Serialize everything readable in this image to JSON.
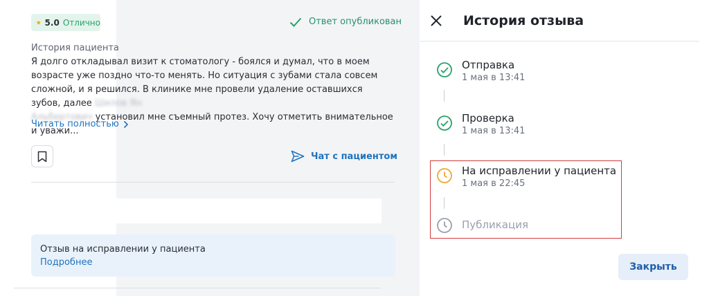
{
  "review": {
    "rating": "5.0",
    "rating_word": "Отлично",
    "published_status": "Ответ опубликован",
    "history_label": "История пациента",
    "text_part1": "Я долго откладывал визит к стоматологу - боялся и думал, что в моем возрасте уже поздно что-то менять. Но ситуация с зубами стала совсем сложной, и я решился. В клинике мне провели удаление оставшихся зубов, далее ",
    "text_blur1": "Шилов Ян",
    "text_blur2": "Альбертович",
    "text_part2": " установил мне съемный протез. Хочу отметить внимательное и уважи...",
    "read_more": "Читать полностью",
    "chat_label": "Чат с пациентом",
    "notice_text": "Отзыв на исправлении у пациента",
    "notice_link": "Подробнее"
  },
  "history_panel": {
    "title": "История отзыва",
    "steps": [
      {
        "name": "Отправка",
        "date": "1 мая в 13:41",
        "status": "done"
      },
      {
        "name": "Проверка",
        "date": "1 мая в 13:41",
        "status": "done"
      },
      {
        "name": "На исправлении у пациента",
        "date": "1 мая в 22:45",
        "status": "current"
      },
      {
        "name": "Публикация",
        "date": "",
        "status": "pending"
      }
    ],
    "close_label": "Закрыть"
  },
  "colors": {
    "success": "#28a26a",
    "warning": "#f0a733",
    "link": "#1e73be",
    "highlight": "#d23a3a"
  },
  "icons": [
    "star-icon",
    "check-icon",
    "chevron-right-icon",
    "bookmark-icon",
    "send-icon",
    "close-icon",
    "check-circle-icon",
    "clock-icon"
  ]
}
